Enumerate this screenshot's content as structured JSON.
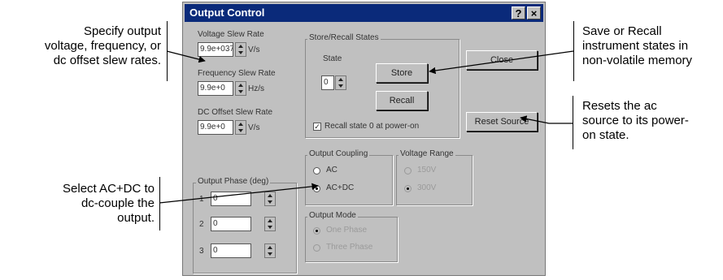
{
  "annotations": {
    "slew_rates": [
      "Specify output",
      "voltage, frequency, or",
      "dc offset slew rates."
    ],
    "select_acdc": [
      "Select AC+DC to",
      "dc-couple the",
      "output."
    ],
    "save_recall": [
      "Save or Recall",
      "instrument states in",
      "non-volatile memory"
    ],
    "reset": [
      "Resets the  ac",
      "source to its power-",
      "on state."
    ]
  },
  "dialog": {
    "title": "Output Control",
    "help_button": "?",
    "close_glyph": "×",
    "voltage_slew": {
      "label": "Voltage Slew Rate",
      "value": "9.9e+037",
      "unit": "V/s"
    },
    "frequency_slew": {
      "label": "Frequency Slew Rate",
      "value": "9.9e+0",
      "unit": "Hz/s"
    },
    "dc_offset_slew": {
      "label": "DC Offset Slew Rate",
      "value": "9.9e+0",
      "unit": "V/s"
    },
    "output_phase": {
      "label": "Output Phase (deg)",
      "rows": [
        {
          "n": "1",
          "value": "0"
        },
        {
          "n": "2",
          "value": "0"
        },
        {
          "n": "3",
          "value": "0"
        }
      ]
    },
    "store_recall": {
      "label": "Store/Recall States",
      "state_label": "State",
      "state_value": "0",
      "store": "Store",
      "recall": "Recall"
    },
    "recall_power_on": {
      "label": "Recall state 0 at power-on",
      "checked": true
    },
    "coupling": {
      "label": "Output Coupling",
      "options": [
        "AC",
        "AC+DC"
      ],
      "selected": "AC+DC"
    },
    "voltage_range": {
      "label": "Voltage Range",
      "options": [
        "150V",
        "300V"
      ],
      "selected": "300V",
      "disabled": true
    },
    "output_mode": {
      "label": "Output Mode",
      "options": [
        "One Phase",
        "Three Phase"
      ],
      "selected": "One Phase",
      "disabled": true
    },
    "close": "Close",
    "reset_source": "Reset Source"
  }
}
